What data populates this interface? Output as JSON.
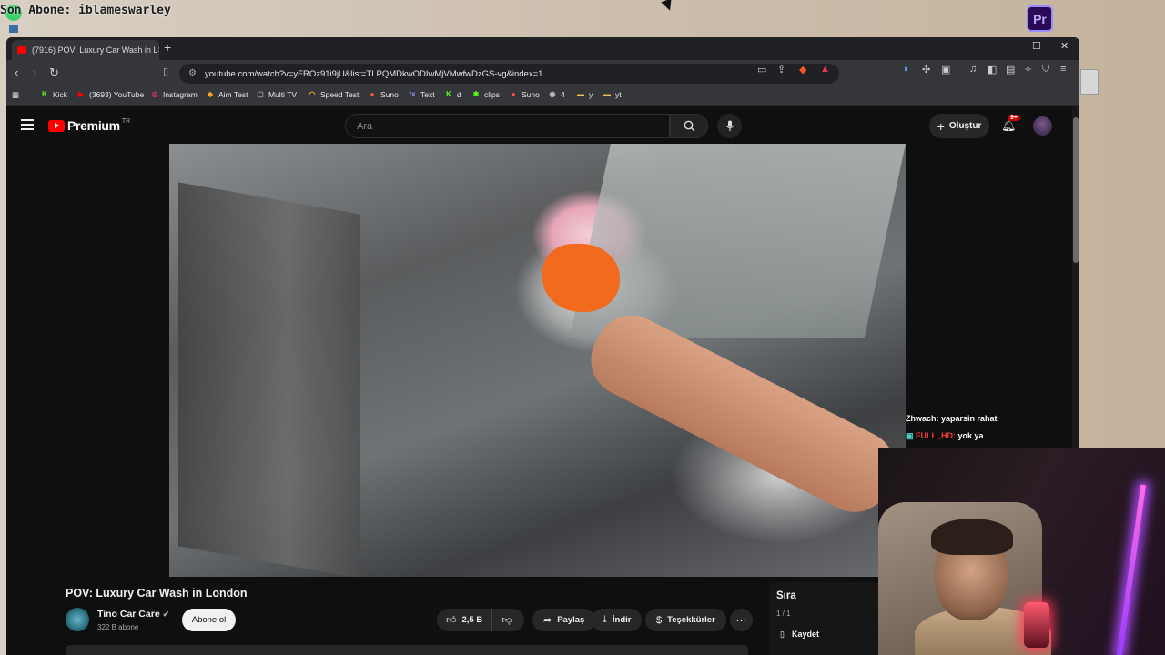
{
  "overlay": {
    "top_text": "Son Abone: iblameswarley",
    "app_icon_label": "Pr"
  },
  "browser": {
    "tab_title": "(7916) POV: Luxury Car Wash in L",
    "tab_close": "×",
    "new_tab": "+",
    "window_controls": {
      "minimize": "─",
      "maximize": "☐",
      "close": "✕"
    },
    "url": "youtube.com/watch?v=yFROz91i9jU&list=TLPQMDkwODIwMjVMwfwDzGS-vg&index=1",
    "bookmarks": [
      {
        "label": "Kick",
        "color": "#53fc18",
        "icon": "K"
      },
      {
        "label": "(3693) YouTube",
        "color": "#ff0000",
        "icon": "▶"
      },
      {
        "label": "Instagram",
        "color": "#e1306c",
        "icon": "◎"
      },
      {
        "label": "Aim Test",
        "color": "#f5a623",
        "icon": "◆"
      },
      {
        "label": "Multi TV",
        "color": "#555555",
        "icon": "▢"
      },
      {
        "label": "Speed Test",
        "color": "#f5a623",
        "icon": "◠"
      },
      {
        "label": "Suno",
        "color": "#ff5a36",
        "icon": "●"
      },
      {
        "label": "Text",
        "color": "#5865f2",
        "icon": "tx"
      },
      {
        "label": "d",
        "color": "#53fc18",
        "icon": "K"
      },
      {
        "label": "clips",
        "color": "#53fc18",
        "icon": "✱"
      },
      {
        "label": "Suno",
        "color": "#ff5a36",
        "icon": "●"
      },
      {
        "label": "4",
        "color": "#888888",
        "icon": "◉"
      },
      {
        "label": "y",
        "color": "#f0c14b",
        "icon": "▬"
      },
      {
        "label": "yt",
        "color": "#f0c14b",
        "icon": "▬"
      }
    ]
  },
  "youtube": {
    "logo_text": "Premium",
    "logo_region": "TR",
    "search_placeholder": "Ara",
    "create_label": "Oluştur",
    "notifications_badge": "9+",
    "video_title": "POV: Luxury Car Wash in London",
    "channel_name": "Tino Car Care",
    "subscribers": "322 B abone",
    "subscribe_label": "Abone ol",
    "likes": "2,5 B",
    "share_label": "Paylaş",
    "download_label": "İndir",
    "thanks_label": "Teşekkürler",
    "queue": {
      "title": "Sıra",
      "count": "1 / 1",
      "save_label": "Kaydet"
    }
  },
  "chat": [
    {
      "user": "Zhwach:",
      "message": " yaparsin rahat"
    },
    {
      "user": "FULL_HD:",
      "message": " yok ya"
    }
  ]
}
